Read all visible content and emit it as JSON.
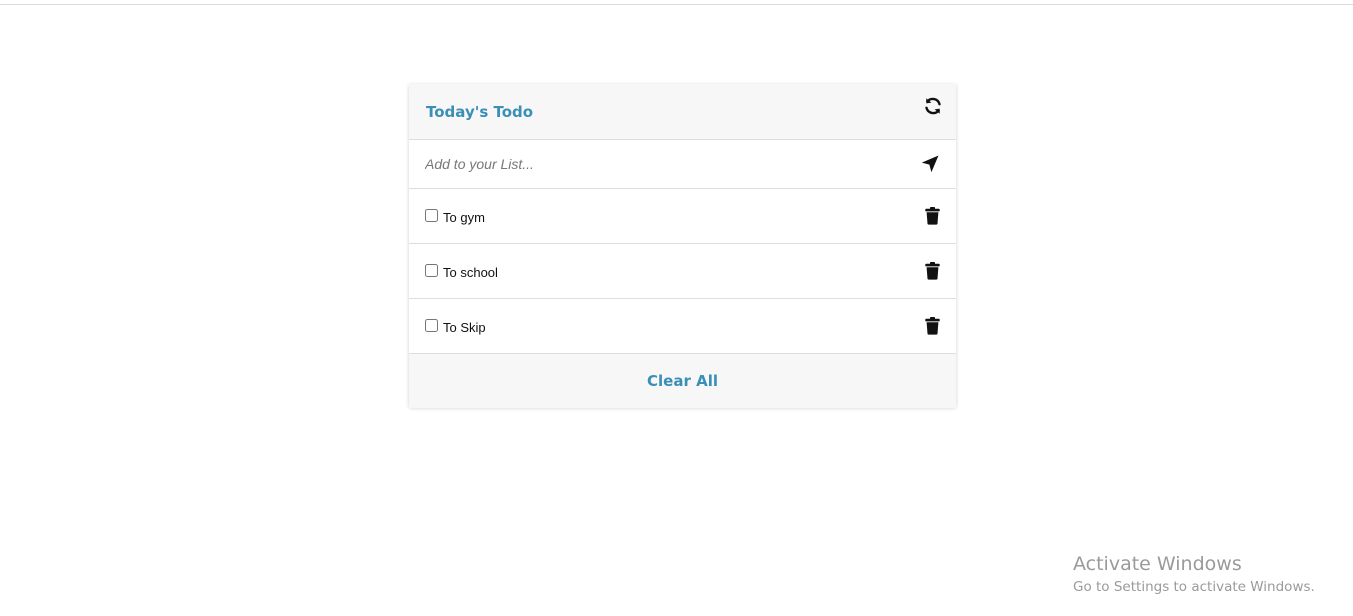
{
  "header": {
    "title": "Today's Todo",
    "refresh_icon": "refresh-icon"
  },
  "add": {
    "placeholder": "Add to your List...",
    "value": "",
    "send_icon": "location-arrow-icon"
  },
  "todos": [
    {
      "label": "To gym",
      "checked": false
    },
    {
      "label": "To school",
      "checked": false
    },
    {
      "label": "To Skip",
      "checked": false
    }
  ],
  "footer": {
    "clear_label": "Clear All"
  },
  "watermark": {
    "title": "Activate Windows",
    "subtitle": "Go to Settings to activate Windows."
  },
  "colors": {
    "accent": "#3a8fb7",
    "header_bg": "#f7f7f7",
    "divider": "#dedede"
  }
}
